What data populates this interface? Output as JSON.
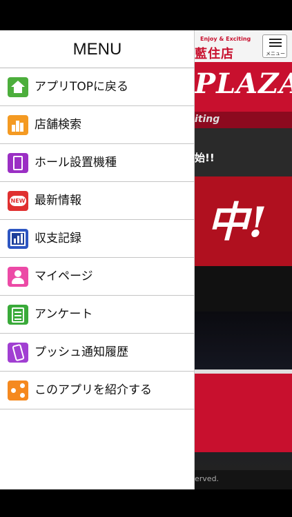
{
  "background": {
    "header_tagline": "Enjoy & Exciting",
    "header_store": "藍住店",
    "menu_button_label": "メニュー",
    "banner_logo": "PLAZA",
    "banner_sub": "iting",
    "notice_fragment": "始!!",
    "promo_fragment": "中!",
    "footer_fragment": "erved."
  },
  "drawer": {
    "title": "MENU",
    "items": [
      {
        "label": "アプリTOPに戻る",
        "icon": "home-icon",
        "color": "#4cae3c"
      },
      {
        "label": "店舗検索",
        "icon": "store-icon",
        "color": "#f49a22"
      },
      {
        "label": "ホール設置機種",
        "icon": "tablet-icon",
        "color": "#9b2fc4"
      },
      {
        "label": "最新情報",
        "icon": "new-badge-icon",
        "color": "#e03030"
      },
      {
        "label": "収支記録",
        "icon": "chart-icon",
        "color": "#2d56c2"
      },
      {
        "label": "マイページ",
        "icon": "person-icon",
        "color": "#ec4aa6"
      },
      {
        "label": "アンケート",
        "icon": "survey-icon",
        "color": "#3aaa3a"
      },
      {
        "label": "プッシュ通知履歴",
        "icon": "push-history-icon",
        "color": "#a13fd2"
      },
      {
        "label": "このアプリを紹介する",
        "icon": "share-icon",
        "color": "#f5891f"
      }
    ]
  }
}
